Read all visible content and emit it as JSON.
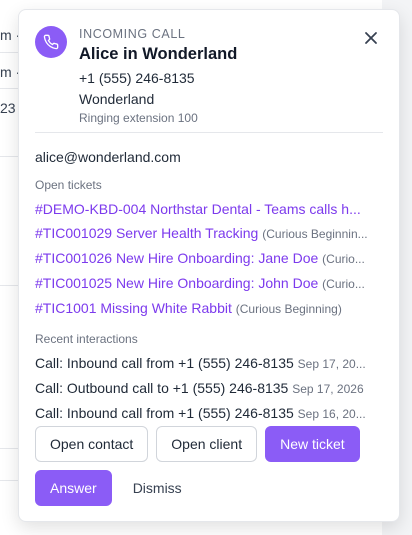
{
  "background": {
    "rows": [
      "m ·",
      "m ·",
      "23"
    ]
  },
  "card": {
    "kicker": "INCOMING CALL",
    "caller_name": "Alice in Wonderland",
    "phone": "+1 (555) 246-8135",
    "organization": "Wonderland",
    "ringing": "Ringing extension 100",
    "email": "alice@wonderland.com",
    "open_tickets_label": "Open tickets",
    "tickets": [
      {
        "title": "#DEMO-KBD-004 Northstar Dental - Teams calls h...",
        "org": ""
      },
      {
        "title": "#TIC001029 Server Health Tracking",
        "org": "(Curious Beginnin..."
      },
      {
        "title": "#TIC001026 New Hire Onboarding: Jane Doe",
        "org": "(Curio..."
      },
      {
        "title": "#TIC001025 New Hire Onboarding: John Doe",
        "org": "(Curio..."
      },
      {
        "title": "#TIC1001 Missing White Rabbit",
        "org": "(Curious Beginning)"
      }
    ],
    "recent_label": "Recent interactions",
    "interactions": [
      {
        "text": "Call: Inbound call from +1 (555) 246-8135",
        "date": "Sep 17, 20..."
      },
      {
        "text": "Call: Outbound call to +1 (555) 246-8135",
        "date": "Sep 17, 2026"
      },
      {
        "text": "Call: Inbound call from +1 (555) 246-8135",
        "date": "Sep 16, 20..."
      }
    ],
    "buttons": {
      "open_contact": "Open contact",
      "open_client": "Open client",
      "new_ticket": "New ticket",
      "answer": "Answer",
      "dismiss": "Dismiss"
    }
  },
  "colors": {
    "accent": "#8b5cf6",
    "link": "#7c3aed"
  },
  "icons": {
    "avatar": "phone-icon",
    "close": "close-icon"
  }
}
